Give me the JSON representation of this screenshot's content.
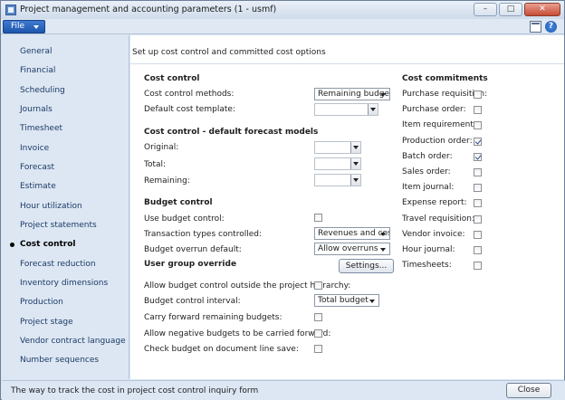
{
  "window": {
    "title": "Project management and accounting parameters (1 - usmf)"
  },
  "window_controls": {
    "minimize": "–",
    "maximize": "□",
    "close": "✕"
  },
  "menu": {
    "file_label": "File",
    "help_icon": "?"
  },
  "sidebar": {
    "items": [
      {
        "label": "General"
      },
      {
        "label": "Financial"
      },
      {
        "label": "Scheduling"
      },
      {
        "label": "Journals"
      },
      {
        "label": "Timesheet"
      },
      {
        "label": "Invoice"
      },
      {
        "label": "Forecast"
      },
      {
        "label": "Estimate"
      },
      {
        "label": "Hour utilization"
      },
      {
        "label": "Project statements"
      },
      {
        "label": "Cost control",
        "active": true
      },
      {
        "label": "Forecast reduction"
      },
      {
        "label": "Inventory dimensions"
      },
      {
        "label": "Production"
      },
      {
        "label": "Project stage"
      },
      {
        "label": "Vendor contract language"
      },
      {
        "label": "Number sequences"
      }
    ]
  },
  "description": "Set up cost control and committed cost options",
  "cost_control": {
    "heading": "Cost control",
    "methods_label": "Cost control methods:",
    "methods_value": "Remaining budget",
    "template_label": "Default cost template:",
    "template_value": ""
  },
  "forecast_models": {
    "heading": "Cost control - default forecast models",
    "original_label": "Original:",
    "total_label": "Total:",
    "remaining_label": "Remaining:"
  },
  "budget_control": {
    "heading": "Budget control",
    "use_label": "Use budget control:",
    "use_checked": false,
    "transaction_label": "Transaction types controlled:",
    "transaction_value": "Revenues and costs",
    "overrun_label": "Budget overrun default:",
    "overrun_value": "Allow overruns",
    "user_group_label": "User group override",
    "settings_button": "Settings...",
    "outside_label": "Allow budget control outside the project hierarchy:",
    "outside_checked": false,
    "interval_label": "Budget control interval:",
    "interval_value": "Total budget",
    "carry_label": "Carry forward remaining budgets:",
    "carry_checked": false,
    "negative_label": "Allow negative budgets to be carried forward:",
    "negative_checked": false,
    "check_label": "Check budget on document line save:",
    "check_checked": false
  },
  "commitments": {
    "heading": "Cost commitments",
    "items": [
      {
        "label": "Purchase requisition:",
        "checked": false
      },
      {
        "label": "Purchase order:",
        "checked": false
      },
      {
        "label": "Item requirement:",
        "checked": false
      },
      {
        "label": "Production order:",
        "checked": true
      },
      {
        "label": "Batch order:",
        "checked": true
      },
      {
        "label": "Sales order:",
        "checked": false
      },
      {
        "label": "Item journal:",
        "checked": false
      },
      {
        "label": "Expense report:",
        "checked": false
      },
      {
        "label": "Travel requisition:",
        "checked": false
      },
      {
        "label": "Vendor invoice:",
        "checked": false
      },
      {
        "label": "Hour journal:",
        "checked": false
      },
      {
        "label": "Timesheets:",
        "checked": false
      }
    ]
  },
  "status": {
    "text": "The way to track the cost in project cost control inquiry form",
    "close_button": "Close"
  }
}
